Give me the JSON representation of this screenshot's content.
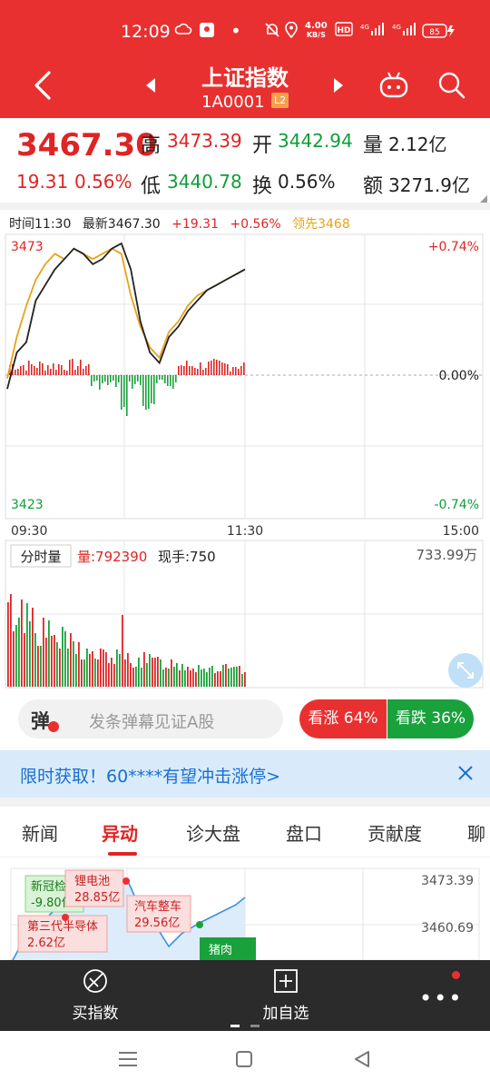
{
  "status_bar": {
    "time": "12:09",
    "net_speed_value": "4.00",
    "net_speed_unit": "KB/S",
    "battery": "85"
  },
  "header": {
    "title": "上证指数",
    "code": "1A0001",
    "level_badge": "L2"
  },
  "quote": {
    "price": "3467.30",
    "change": "19.31",
    "change_pct": "0.56%",
    "high_label": "高",
    "high": "3473.39",
    "open_label": "开",
    "open": "3442.94",
    "volume_label": "量",
    "volume": "2.12亿",
    "low_label": "低",
    "low": "3440.78",
    "turnover_label": "换",
    "turnover": "0.56%",
    "amount_label": "额",
    "amount": "3271.9亿"
  },
  "intraday": {
    "time_text": "时间11:30",
    "latest_text": "最新3467.30",
    "change_text": "+19.31",
    "change_pct_text": "+0.56%",
    "leader_text": "领先3468",
    "y_high": "3473",
    "y_low": "3423",
    "pct_high": "+0.74%",
    "pct_mid": "0.00%",
    "pct_low": "-0.74%",
    "x_start": "09:30",
    "x_mid": "11:30",
    "x_end": "15:00"
  },
  "volume_panel": {
    "label": "分时量",
    "volume_text": "量:792390",
    "current_text": "现手:750",
    "max_text": "733.99万"
  },
  "chart_data": {
    "type": "line",
    "series": [
      {
        "values": [
          3445,
          3452,
          3454,
          3462,
          3465,
          3468,
          3470,
          3472,
          3471,
          3469,
          3470,
          3472,
          3473,
          3468,
          3458,
          3452,
          3450,
          3455,
          3457,
          3460,
          3462,
          3464,
          3465,
          3466,
          3467,
          3468
        ]
      },
      {
        "values": [
          3447,
          3455,
          3461,
          3466,
          3469,
          3471,
          3470,
          3472,
          3471,
          3470,
          3471,
          3472,
          3471,
          3463,
          3457,
          3453,
          3451,
          3456,
          3458,
          3461,
          3463,
          3464,
          3465,
          3466,
          3467,
          3468
        ]
      }
    ],
    "ylim": [
      3423,
      3473
    ],
    "grid": true
  },
  "danmu": {
    "badge": "弹",
    "placeholder": "发条弹幕见证A股"
  },
  "sentiment": {
    "up_label": "看涨 64%",
    "down_label": "看跌 36%"
  },
  "banner": {
    "text": "限时获取！60****有望冲击涨停>"
  },
  "tabs": [
    "新闻",
    "异动",
    "诊大盘",
    "盘口",
    "贡献度",
    "聊"
  ],
  "events": {
    "price_high": "3473.39",
    "price_mid": "3460.69",
    "tags": [
      {
        "name": "新冠检测",
        "value": "-9.80亿"
      },
      {
        "name": "锂电池",
        "value": "28.85亿"
      },
      {
        "name": "汽车整车",
        "value": "29.56亿"
      },
      {
        "name": "第三代半导体",
        "value": "2.62亿"
      },
      {
        "name": "猪肉"
      }
    ]
  },
  "bottom_bar": {
    "buy_label": "买指数",
    "add_label": "加自选"
  },
  "colors": {
    "brand_red": "#e93030",
    "up": "#e02424",
    "down": "#0f9d3a",
    "avg_line": "#e8a317"
  }
}
